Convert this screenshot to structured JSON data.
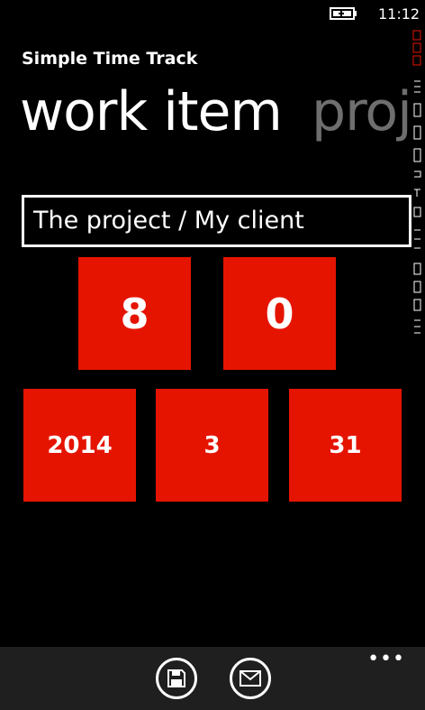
{
  "status_bar": {
    "time": "11:12",
    "battery_icon": "battery-charging-icon"
  },
  "app": {
    "title": "Simple Time Track"
  },
  "pivot": {
    "active": "work item",
    "next": "proj"
  },
  "project": {
    "value": "The project / My client"
  },
  "time_tiles": {
    "hours": "8",
    "minutes": "0"
  },
  "date_tiles": {
    "year": "2014",
    "month": "3",
    "day": "31"
  },
  "app_bar": {
    "save_icon": "save-icon",
    "mail_icon": "mail-icon",
    "more_label": "•••"
  },
  "colors": {
    "accent": "#e51400",
    "background": "#000000",
    "app_bar": "#1f1f1f",
    "pivot_inactive": "#6e6e6e"
  }
}
